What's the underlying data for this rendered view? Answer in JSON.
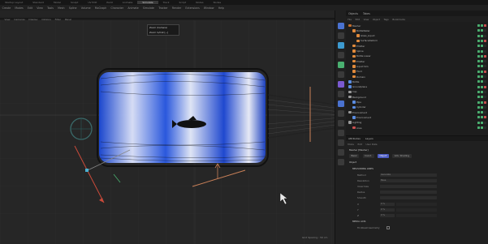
{
  "app": {
    "tabs": [
      "Startup Layout",
      "Standard",
      "Model",
      "Sculpt",
      "UV Edit",
      "Paint",
      "Animate",
      "Simulate",
      "Track",
      "Script",
      "Nodes",
      "Nodes"
    ],
    "active_tab_index": 7
  },
  "menu": [
    "Create",
    "Modes",
    "Edit",
    "View",
    "Tools",
    "Mesh",
    "Spline",
    "Volume",
    "MoGraph",
    "Character",
    "Animate",
    "Simulate",
    "Tracker",
    "Render",
    "Extensions",
    "Window",
    "Help"
  ],
  "view_menu": [
    "View",
    "Cameras",
    "Display",
    "Options",
    "Filter",
    "Panel"
  ],
  "tooltip": {
    "title": "Zoom (Camera)",
    "line2": "Zoom In/Out  [~]"
  },
  "status_text": "Grid Spacing : 50 cm",
  "panel": {
    "tabs": [
      "Objects",
      "Takes"
    ],
    "menu": [
      "File",
      "Edit",
      "View",
      "Object",
      "Tags",
      "Bookmarks"
    ],
    "objects": [
      {
        "name": "Mesher",
        "level": 0,
        "color": "#c56e2c"
      },
      {
        "name": "BottleWater",
        "level": 1,
        "color": "#e08a3c"
      },
      {
        "name": "Glass_Liquid",
        "level": 2,
        "color": "#e08a3c"
      },
      {
        "name": "SurfaceDeform",
        "level": 2,
        "color": "#e08a3c"
      },
      {
        "name": "Emitter",
        "level": 1,
        "color": "#e08a3c"
      },
      {
        "name": "Spline",
        "level": 1,
        "color": "#e08a3c"
      },
      {
        "name": "Bottle Lower",
        "level": 1,
        "color": "#e08a3c"
      },
      {
        "name": "Emitter",
        "level": 1,
        "color": "#e08a3c"
      },
      {
        "name": "Liquid Sim",
        "level": 1,
        "color": "#e08a3c"
      },
      {
        "name": "Fluid",
        "level": 1,
        "color": "#e08a3c"
      },
      {
        "name": "Domain",
        "level": 1,
        "color": "#e08a3c"
      },
      {
        "name": "Bottle",
        "level": 0,
        "color": "#5a8ce0"
      },
      {
        "name": "Groundplane",
        "level": 0,
        "color": "#5a8ce0"
      },
      {
        "name": "Cap",
        "level": 0,
        "color": "#9a9a9a"
      },
      {
        "name": "Background",
        "level": 0,
        "color": "#9a9a9a"
      },
      {
        "name": "Pipe",
        "level": 1,
        "color": "#5a8ce0"
      },
      {
        "name": "Cylinder",
        "level": 1,
        "color": "#5a8ce0"
      },
      {
        "name": "Environment",
        "level": 0,
        "color": "#9a9a9a"
      },
      {
        "name": "Environment",
        "level": 1,
        "color": "#5a8ce0"
      },
      {
        "name": "Lighting",
        "level": 0,
        "color": "#9a9a9a"
      },
      {
        "name": "Area",
        "level": 1,
        "color": "#c85050"
      }
    ],
    "attr_tabs": [
      "Attributes",
      "Layers"
    ],
    "attr_menu": [
      "Mode",
      "Edit",
      "User Data"
    ],
    "attr_object": "Mesher [Mesher]",
    "attr_buttons": [
      "Basic",
      "Coord.",
      "Object",
      "Adv. Shading"
    ],
    "attr_active_button": 2,
    "section_title": "Object",
    "sub_section": "MEASURING LINES",
    "fields": [
      {
        "label": "Method",
        "value": "Generate"
      },
      {
        "label": "Resolution",
        "value": "Base"
      },
      {
        "label": "Voxel Size",
        "value": ""
      },
      {
        "label": "Radius",
        "value": ""
      },
      {
        "label": "Smooth",
        "value": ""
      }
    ],
    "small_fields": [
      {
        "label": "X",
        "value": "0 %"
      },
      {
        "label": "Y",
        "value": "0 %"
      },
      {
        "label": "Z",
        "value": "0 %"
      }
    ],
    "footer_section": "MEDIA AXIS",
    "footer_check": "Trickbeat Geometry"
  }
}
